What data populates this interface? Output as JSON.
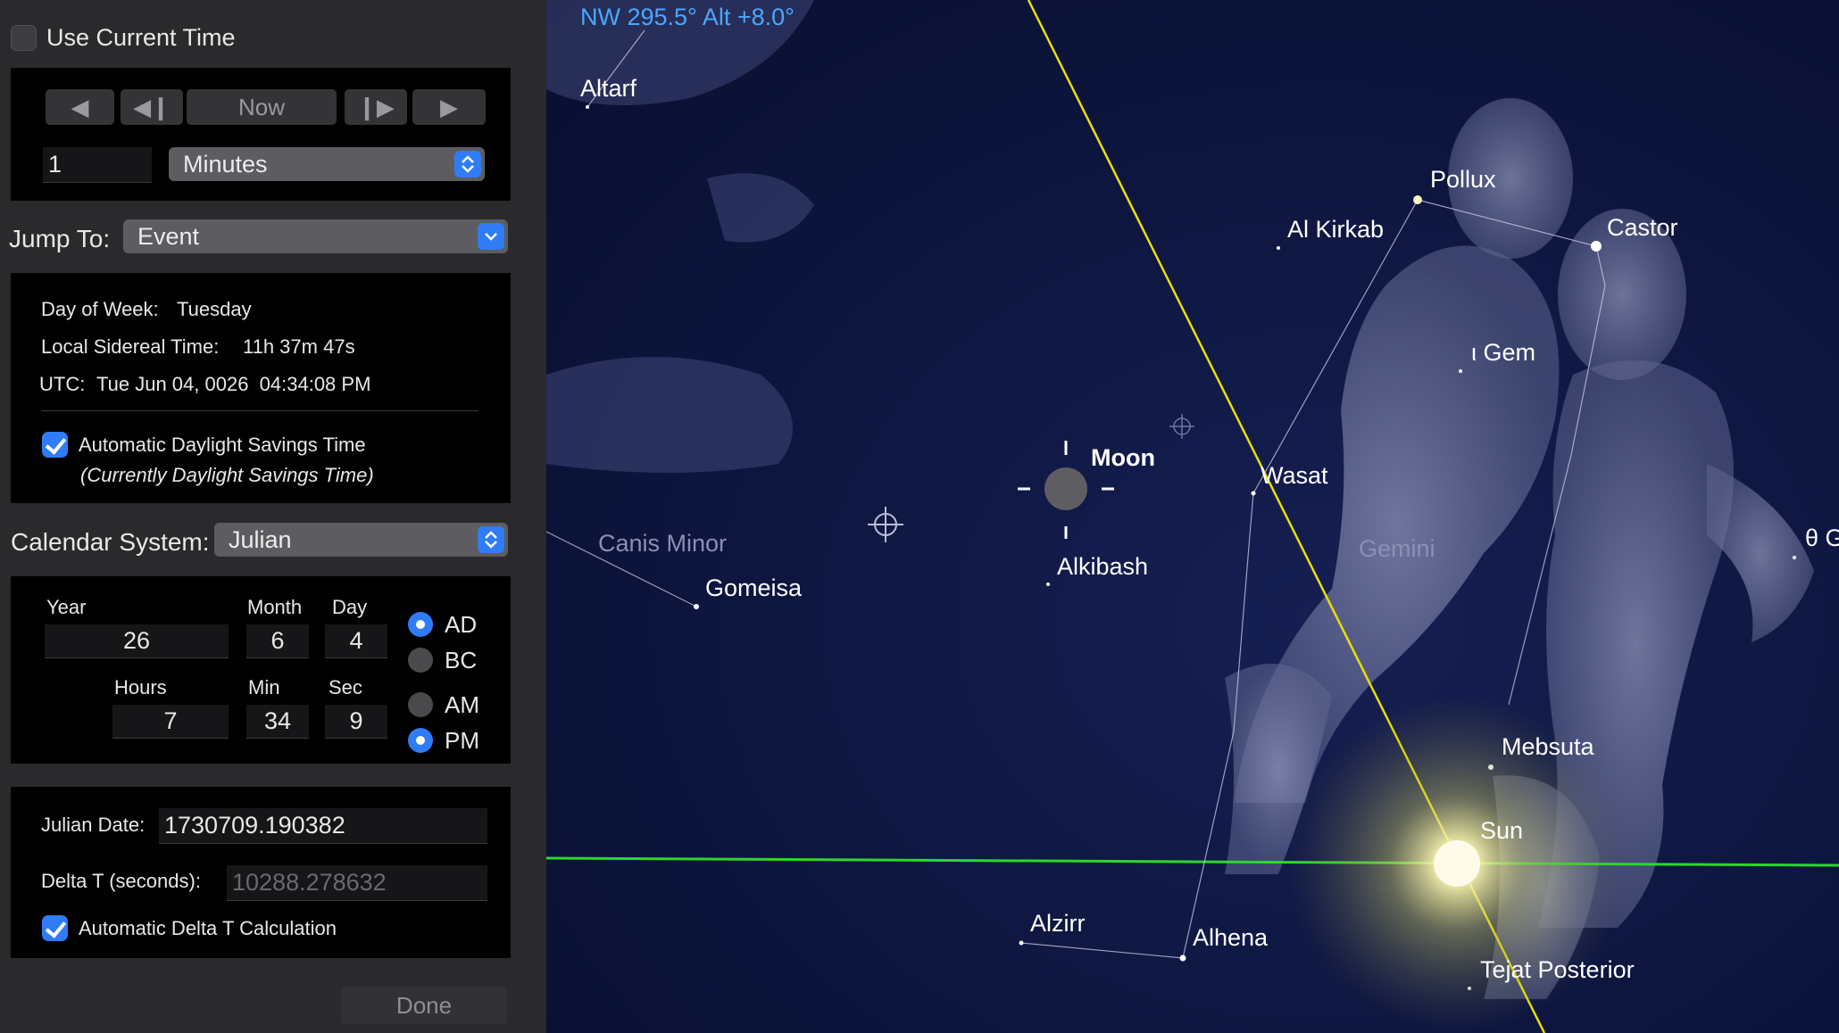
{
  "panel": {
    "use_current_time": {
      "label": "Use Current Time",
      "checked": false
    },
    "step": {
      "now_label": "Now",
      "amount": "1",
      "unit": "Minutes"
    },
    "jump_to": {
      "label": "Jump To:",
      "value": "Event"
    },
    "info": {
      "day_of_week_label": "Day of Week:",
      "day_of_week": "Tuesday",
      "lst_label": "Local Sidereal Time:",
      "lst": "11h 37m 47s",
      "utc_label": "UTC:",
      "utc": "Tue Jun 04, 0026  04:34:08 PM",
      "dst_label": "Automatic Daylight Savings Time",
      "dst_checked": true,
      "dst_note": "(Currently Daylight Savings Time)"
    },
    "calendar": {
      "label": "Calendar System:",
      "value": "Julian"
    },
    "date": {
      "year_label": "Year",
      "year": "26",
      "month_label": "Month",
      "month": "6",
      "day_label": "Day",
      "day": "4",
      "hours_label": "Hours",
      "hours": "7",
      "min_label": "Min",
      "min": "34",
      "sec_label": "Sec",
      "sec": "9",
      "ad_label": "AD",
      "bc_label": "BC",
      "era": "AD",
      "am_label": "AM",
      "pm_label": "PM",
      "meridiem": "PM"
    },
    "julian": {
      "jd_label": "Julian Date:",
      "jd": "1730709.190382",
      "delta_t_label": "Delta T (seconds):",
      "delta_t": "10288.278632",
      "auto_delta_label": "Automatic Delta T Calculation",
      "auto_delta_checked": true
    },
    "done_label": "Done"
  },
  "sky": {
    "readout": "NW 295.5° Alt +8.0°",
    "constellations": [
      "Gemini",
      "Canis Minor"
    ],
    "stars": [
      "Altarf",
      "Pollux",
      "Castor",
      "Al Kirkab",
      "ι Gem",
      "Wasat",
      "Alkibash",
      "Gomeisa",
      "Mebsuta",
      "Alzirr",
      "Alhena",
      "Tejat Posterior",
      "θ G"
    ],
    "moon_label": "Moon",
    "sun_label": "Sun",
    "colors": {
      "ecliptic": "#e8e000",
      "horizon": "#2bd82b",
      "readout": "#4aa8ff",
      "accent": "#2f7cf6"
    }
  }
}
